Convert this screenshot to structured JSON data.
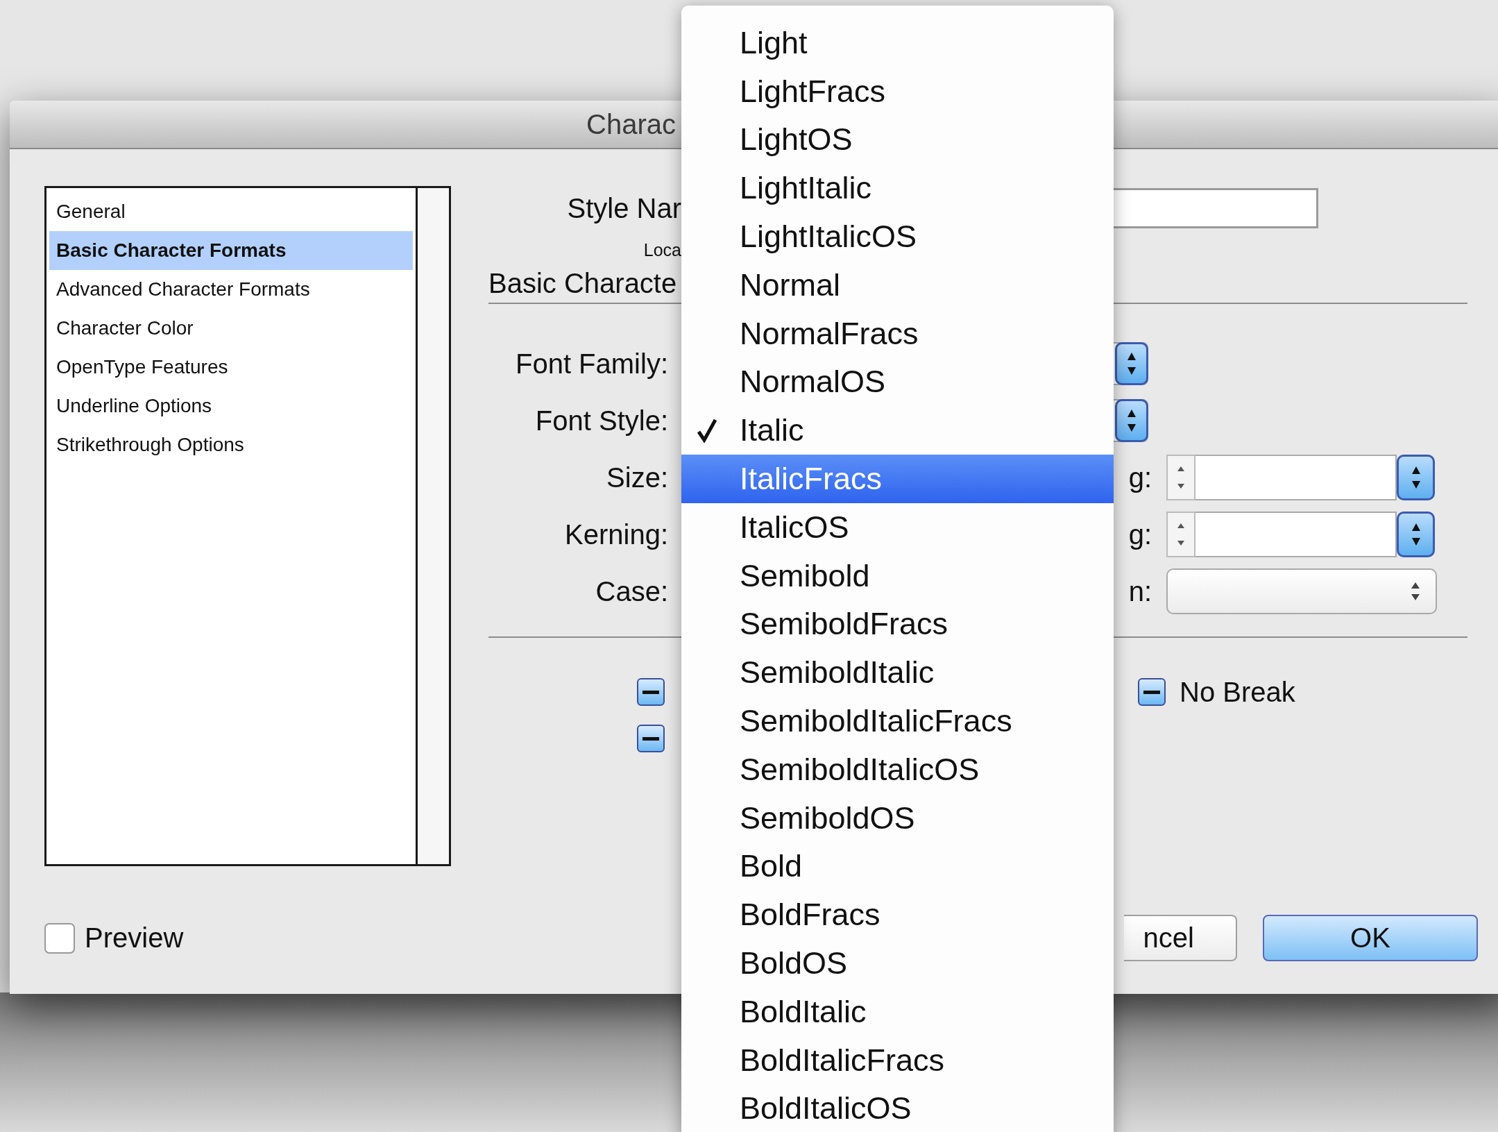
{
  "window": {
    "title": "Charac"
  },
  "sidebar": {
    "items": [
      {
        "label": "General",
        "selected": false
      },
      {
        "label": "Basic Character Formats",
        "selected": true
      },
      {
        "label": "Advanced Character Formats",
        "selected": false
      },
      {
        "label": "Character Color",
        "selected": false
      },
      {
        "label": "OpenType Features",
        "selected": false
      },
      {
        "label": "Underline Options",
        "selected": false
      },
      {
        "label": "Strikethrough Options",
        "selected": false
      }
    ]
  },
  "form": {
    "style_name_label": "Style Nar",
    "location_label": "Loca",
    "section_title": "Basic Characte",
    "rows": [
      {
        "label": "Font Family:",
        "kind": "popup"
      },
      {
        "label": "Font Style:",
        "kind": "popup"
      },
      {
        "label": "Size:",
        "kind": "combo",
        "right_label": "g:"
      },
      {
        "label": "Kerning:",
        "kind": "combo",
        "right_label": "g:"
      },
      {
        "label": "Case:",
        "kind": "select",
        "right_label": "n:"
      }
    ],
    "options": [
      {
        "mixed": true,
        "label": "No Break",
        "mixed_right": true
      },
      {
        "mixed": true
      }
    ]
  },
  "preview": {
    "label": "Preview",
    "checked": false
  },
  "buttons": [
    {
      "label": "ncel",
      "kind": "cancel"
    },
    {
      "label": "OK",
      "kind": "default"
    }
  ],
  "menu": {
    "items": [
      {
        "label": "Light",
        "checked": false,
        "selected": false
      },
      {
        "label": "LightFracs",
        "checked": false,
        "selected": false
      },
      {
        "label": "LightOS",
        "checked": false,
        "selected": false
      },
      {
        "label": "LightItalic",
        "checked": false,
        "selected": false
      },
      {
        "label": "LightItalicOS",
        "checked": false,
        "selected": false
      },
      {
        "label": "Normal",
        "checked": false,
        "selected": false
      },
      {
        "label": "NormalFracs",
        "checked": false,
        "selected": false
      },
      {
        "label": "NormalOS",
        "checked": false,
        "selected": false
      },
      {
        "label": "Italic",
        "checked": true,
        "selected": false
      },
      {
        "label": "ItalicFracs",
        "checked": false,
        "selected": true
      },
      {
        "label": "ItalicOS",
        "checked": false,
        "selected": false
      },
      {
        "label": "Semibold",
        "checked": false,
        "selected": false
      },
      {
        "label": "SemiboldFracs",
        "checked": false,
        "selected": false
      },
      {
        "label": "SemiboldItalic",
        "checked": false,
        "selected": false
      },
      {
        "label": "SemiboldItalicFracs",
        "checked": false,
        "selected": false
      },
      {
        "label": "SemiboldItalicOS",
        "checked": false,
        "selected": false
      },
      {
        "label": "SemiboldOS",
        "checked": false,
        "selected": false
      },
      {
        "label": "Bold",
        "checked": false,
        "selected": false
      },
      {
        "label": "BoldFracs",
        "checked": false,
        "selected": false
      },
      {
        "label": "BoldOS",
        "checked": false,
        "selected": false
      },
      {
        "label": "BoldItalic",
        "checked": false,
        "selected": false
      },
      {
        "label": "BoldItalicFracs",
        "checked": false,
        "selected": false
      },
      {
        "label": "BoldItalicOS",
        "checked": false,
        "selected": false
      }
    ]
  }
}
